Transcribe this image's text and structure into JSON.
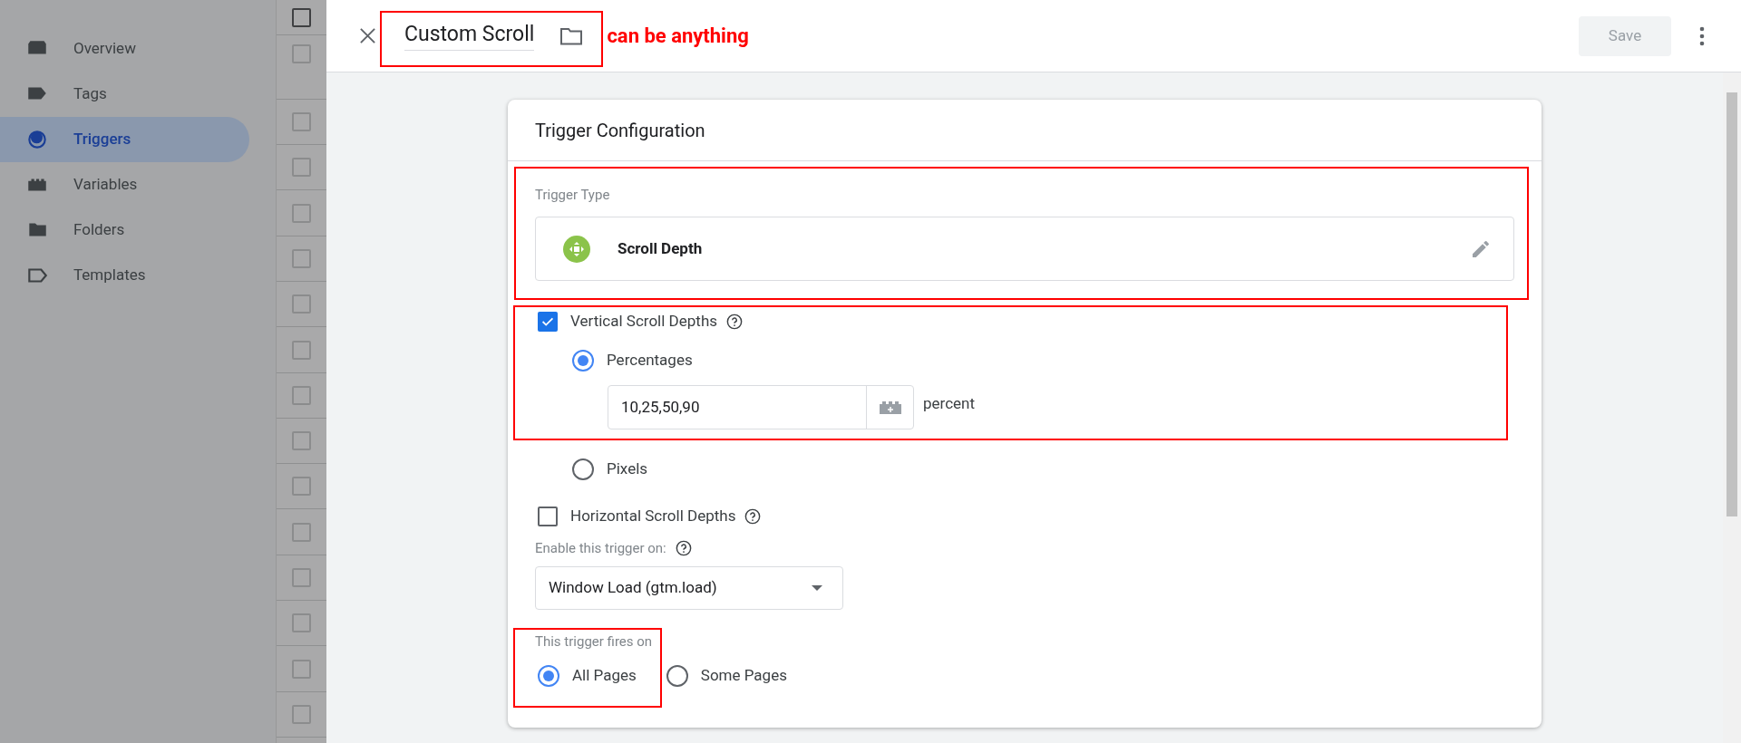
{
  "sidebar": {
    "items": [
      {
        "label": "Overview",
        "selected": false
      },
      {
        "label": "Tags",
        "selected": false
      },
      {
        "label": "Triggers",
        "selected": true
      },
      {
        "label": "Variables",
        "selected": false
      },
      {
        "label": "Folders",
        "selected": false
      },
      {
        "label": "Templates",
        "selected": false
      }
    ]
  },
  "background_list": {
    "rows": [
      {
        "checked": false
      },
      {
        "checked": false
      },
      {
        "checked": false
      },
      {
        "checked": false
      },
      {
        "checked": false
      },
      {
        "checked": false
      },
      {
        "checked": false
      },
      {
        "checked": false
      },
      {
        "checked": false
      },
      {
        "checked": false
      },
      {
        "checked": false
      },
      {
        "checked": false
      },
      {
        "checked": false
      },
      {
        "checked": false
      },
      {
        "checked": false
      },
      {
        "checked": false
      }
    ]
  },
  "header": {
    "title": "Custom Scroll",
    "annotation": "can be anything",
    "save": {
      "label": "Save",
      "disabled": true
    }
  },
  "card": {
    "title": "Trigger Configuration",
    "trigger_type": {
      "label": "Trigger Type",
      "value": "Scroll Depth"
    },
    "vertical": {
      "label": "Vertical Scroll Depths",
      "checked": true,
      "options": [
        {
          "label": "Percentages",
          "selected": true
        },
        {
          "label": "Pixels",
          "selected": false
        }
      ],
      "input": {
        "value": "10,25,50,90",
        "unit": "percent"
      }
    },
    "horizontal": {
      "label": "Horizontal Scroll Depths",
      "checked": false
    },
    "enable_on": {
      "label": "Enable this trigger on:",
      "value": "Window Load (gtm.load)"
    },
    "fires_on": {
      "label": "This trigger fires on",
      "options": [
        {
          "label": "All Pages",
          "selected": true
        },
        {
          "label": "Some Pages",
          "selected": false
        }
      ]
    }
  }
}
